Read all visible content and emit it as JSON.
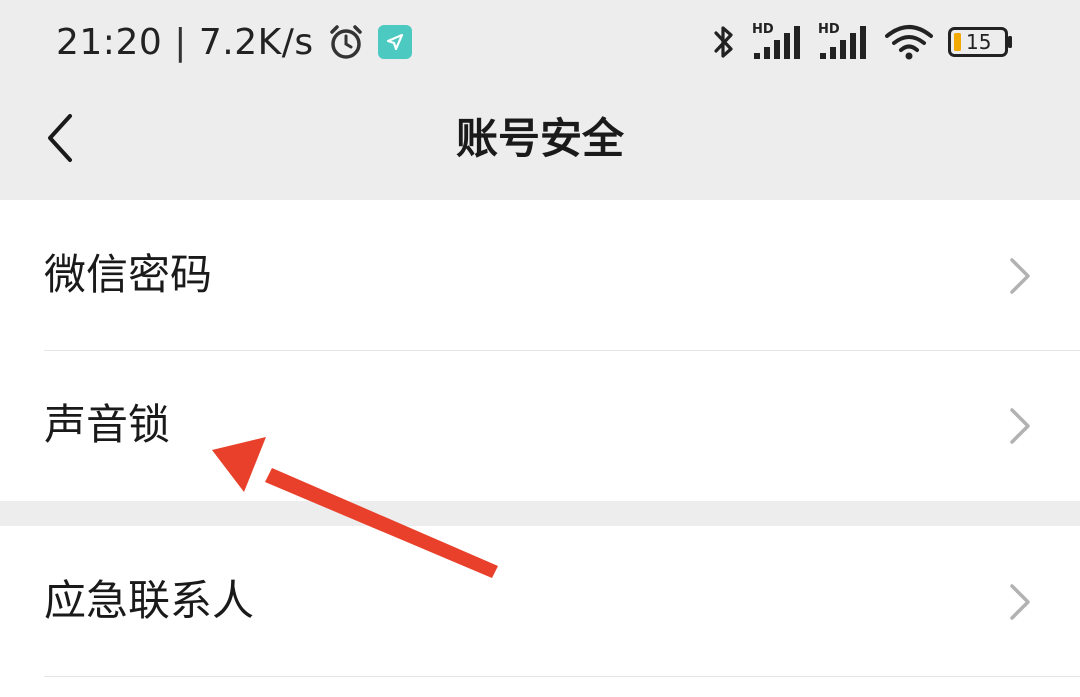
{
  "status_bar": {
    "time": "21:20",
    "separator": "|",
    "net_speed": "7.2K/s",
    "battery_level": "15",
    "signal_1_label": "HD",
    "signal_2_label": "HD",
    "icons": [
      "alarm-icon",
      "location-arrow-icon",
      "bluetooth-icon",
      "signal-icon",
      "wifi-icon",
      "battery-icon"
    ]
  },
  "header": {
    "title": "账号安全",
    "back_icon": "chevron-left-icon"
  },
  "settings": {
    "group1": [
      {
        "label": "微信密码"
      },
      {
        "label": "声音锁"
      }
    ],
    "group2": [
      {
        "label": "应急联系人"
      }
    ]
  },
  "colors": {
    "background": "#ededed",
    "card": "#ffffff",
    "arrow": "#e8402a",
    "nav_badge": "#4cc9c0"
  }
}
